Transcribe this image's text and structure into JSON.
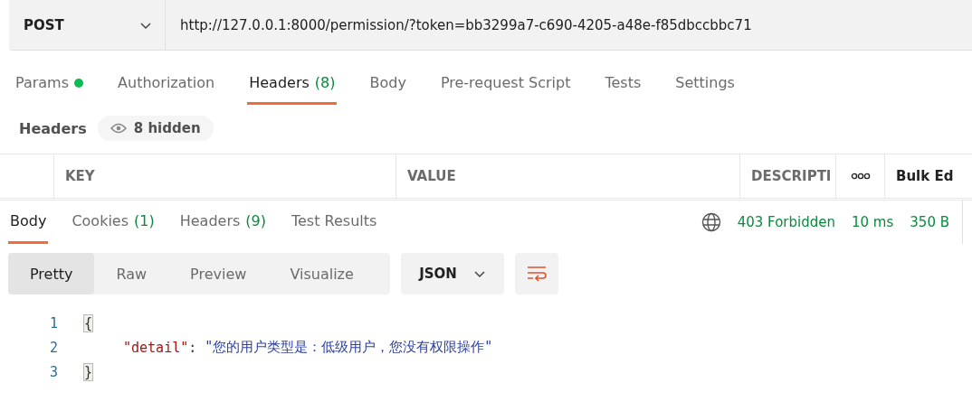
{
  "request": {
    "method": "POST",
    "url": "http://127.0.0.1:8000/permission/?token=bb3299a7-c690-4205-a48e-f85dbccbbc71"
  },
  "request_tabs": [
    {
      "label": "Params",
      "dot": true,
      "selected": false
    },
    {
      "label": "Authorization",
      "dot": false,
      "selected": false
    },
    {
      "label": "Headers",
      "count": "(8)",
      "dot": false,
      "selected": true
    },
    {
      "label": "Body",
      "dot": false,
      "selected": false
    },
    {
      "label": "Pre-request Script",
      "dot": false,
      "selected": false
    },
    {
      "label": "Tests",
      "dot": false,
      "selected": false
    },
    {
      "label": "Settings",
      "dot": false,
      "selected": false
    }
  ],
  "headers_bar": {
    "title": "Headers",
    "hidden_toggle": "8 hidden"
  },
  "table": {
    "columns": [
      "KEY",
      "VALUE",
      "DESCRIPTI"
    ],
    "bulk_edit": "Bulk Ed"
  },
  "response_tabs": [
    {
      "label": "Body",
      "selected": true
    },
    {
      "label": "Cookies",
      "count": "(1)",
      "selected": false
    },
    {
      "label": "Headers",
      "count": "(9)",
      "selected": false
    },
    {
      "label": "Test Results",
      "selected": false
    }
  ],
  "status": {
    "code": "403 Forbidden",
    "time": "10 ms",
    "size": "350 B"
  },
  "view_modes": [
    {
      "label": "Pretty",
      "selected": true
    },
    {
      "label": "Raw",
      "selected": false
    },
    {
      "label": "Preview",
      "selected": false
    },
    {
      "label": "Visualize",
      "selected": false
    }
  ],
  "format": "JSON",
  "code_lines": [
    {
      "number": "1",
      "tokens": [
        {
          "kind": "brace",
          "text": "{"
        }
      ]
    },
    {
      "number": "2",
      "tokens": [
        {
          "kind": "key",
          "text": "\"detail\""
        },
        {
          "kind": "punct",
          "text": ": "
        },
        {
          "kind": "string",
          "text": "\"您的用户类型是：低级用户，您没有权限操作\""
        }
      ]
    },
    {
      "number": "3",
      "tokens": [
        {
          "kind": "brace",
          "text": "}"
        }
      ]
    }
  ]
}
